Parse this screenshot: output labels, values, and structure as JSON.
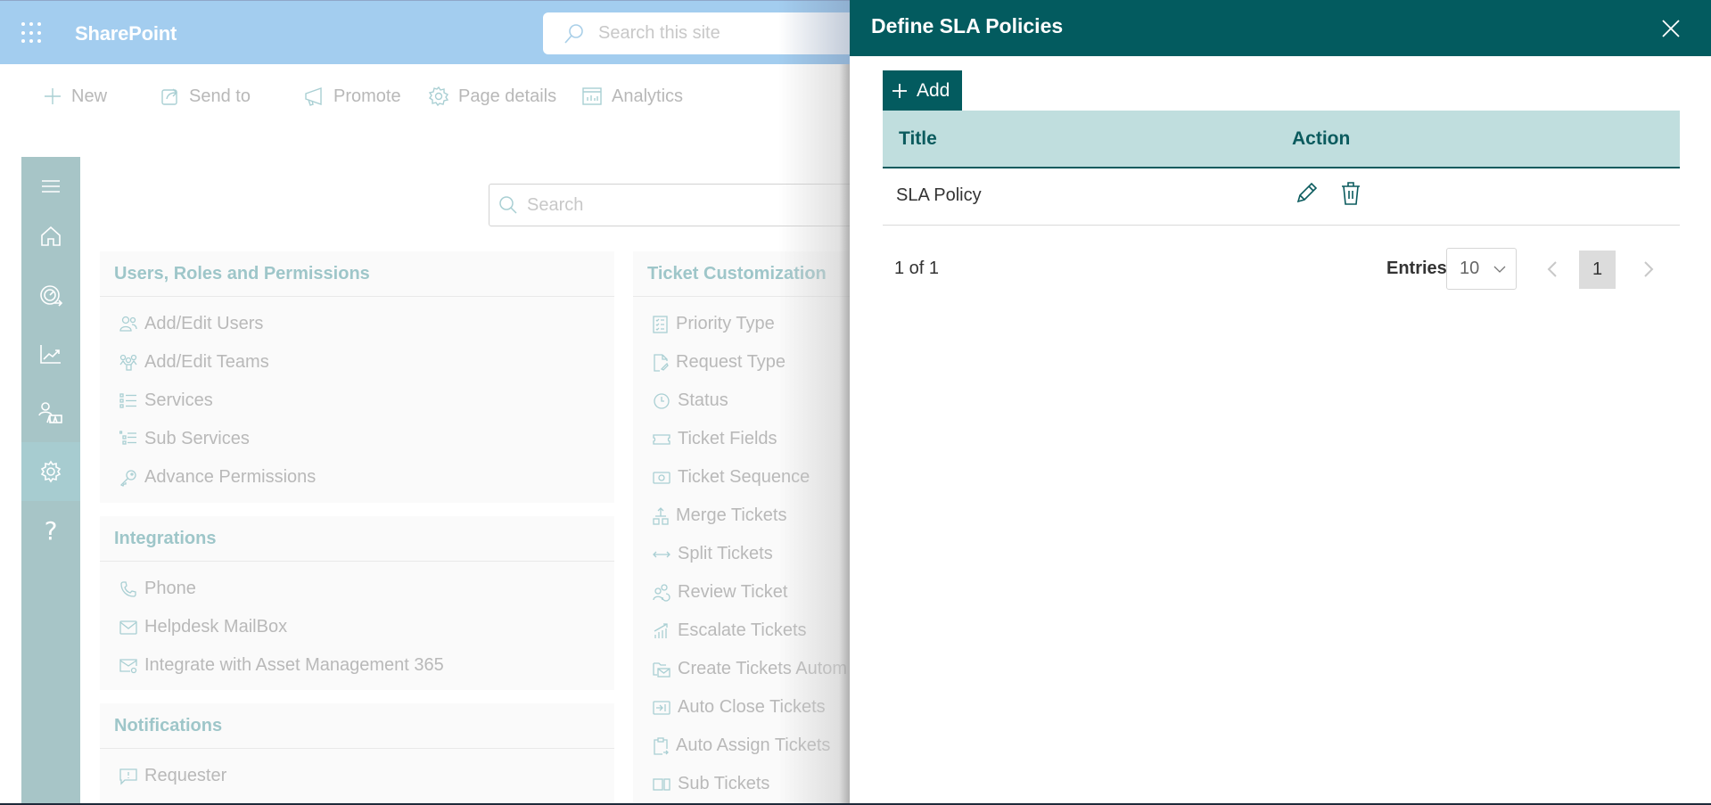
{
  "suite_bar": {
    "app_name": "SharePoint",
    "search_placeholder": "Search this site",
    "color": "#a3cdef"
  },
  "command_bar": {
    "items": [
      {
        "label": "New",
        "icon": "plus-icon"
      },
      {
        "label": "Send to",
        "icon": "share-icon"
      },
      {
        "label": "Promote",
        "icon": "megaphone-icon"
      },
      {
        "label": "Page details",
        "icon": "gear-icon"
      },
      {
        "label": "Analytics",
        "icon": "analytics-icon"
      }
    ]
  },
  "nav_rail": {
    "items": [
      {
        "name": "menu",
        "icon": "hamburger-icon"
      },
      {
        "name": "home",
        "icon": "home-icon"
      },
      {
        "name": "dashboard",
        "icon": "speedometer-icon"
      },
      {
        "name": "reports",
        "icon": "chart-line-icon"
      },
      {
        "name": "users",
        "icon": "people-icon"
      },
      {
        "name": "settings",
        "icon": "gear-icon",
        "active": true
      },
      {
        "name": "help",
        "icon": "question-icon",
        "glyph": "?"
      }
    ],
    "color": "#a7c5c7"
  },
  "page_search": {
    "placeholder": "Search"
  },
  "sections": {
    "users_roles": {
      "title": "Users, Roles and Permissions",
      "items": [
        "Add/Edit Users",
        "Add/Edit Teams",
        "Services",
        "Sub Services",
        "Advance Permissions"
      ]
    },
    "integrations": {
      "title": "Integrations",
      "items": [
        "Phone",
        "Helpdesk MailBox",
        "Integrate with Asset Management 365"
      ]
    },
    "notifications": {
      "title": "Notifications",
      "items": [
        "Requester"
      ]
    },
    "ticket_customization": {
      "title": "Ticket Customization",
      "items": [
        "Priority Type",
        "Request Type",
        "Status",
        "Ticket Fields",
        "Ticket Sequence",
        "Merge Tickets",
        "Split Tickets",
        "Review Ticket",
        "Escalate Tickets",
        "Create Tickets Autom",
        "Auto Close Tickets",
        "Auto Assign Tickets",
        "Sub Tickets"
      ]
    }
  },
  "panel": {
    "title": "Define SLA Policies",
    "header_color": "#035b5f",
    "add_label": "Add",
    "table": {
      "columns": [
        "Title",
        "Action"
      ],
      "rows": [
        {
          "title": "SLA Policy"
        }
      ]
    },
    "pagination": {
      "count_text": "1 of 1",
      "entries_label": "Entries",
      "entries_value": "10",
      "current_page": "1"
    }
  }
}
